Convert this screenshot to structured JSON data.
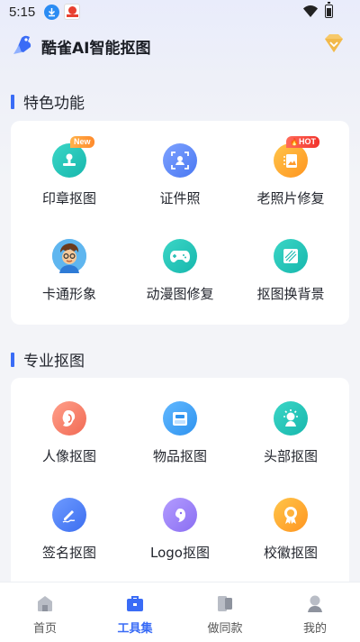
{
  "status_bar": {
    "time": "5:15"
  },
  "header": {
    "title": "酷雀AI智能抠图"
  },
  "featured": {
    "title": "特色功能",
    "items": [
      {
        "label": "印章抠图",
        "badge": "New"
      },
      {
        "label": "证件照"
      },
      {
        "label": "老照片修复",
        "badge": "HOT"
      },
      {
        "label": "卡通形象"
      },
      {
        "label": "动漫图修复"
      },
      {
        "label": "抠图换背景"
      }
    ]
  },
  "professional": {
    "title": "专业抠图",
    "items": [
      {
        "label": "人像抠图"
      },
      {
        "label": "物品抠图"
      },
      {
        "label": "头部抠图"
      },
      {
        "label": "签名抠图"
      },
      {
        "label": "Logo抠图"
      },
      {
        "label": "校徽抠图"
      }
    ]
  },
  "tab_bar": {
    "tabs": [
      {
        "label": "首页"
      },
      {
        "label": "工具集",
        "active": true
      },
      {
        "label": "做同款"
      },
      {
        "label": "我的"
      }
    ]
  },
  "colors": {
    "accent": "#3a6cf6",
    "new_badge": "#ff9a35",
    "hot_badge": "#f2332b"
  }
}
